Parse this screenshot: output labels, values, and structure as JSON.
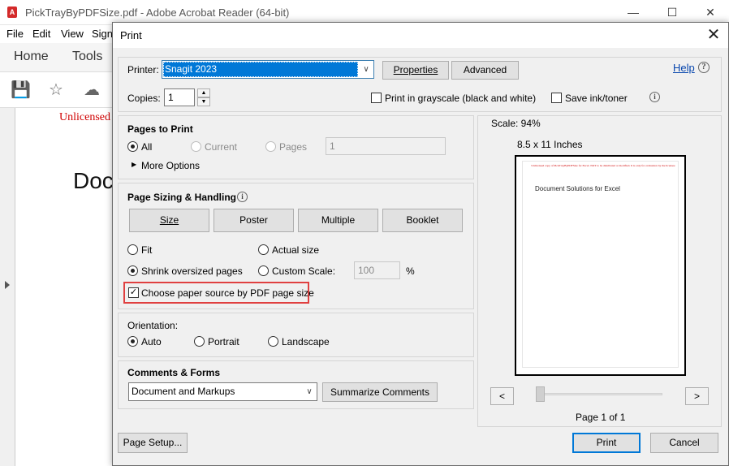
{
  "background": {
    "window_title": "PickTrayByPDFSize.pdf - Adobe Acrobat Reader (64-bit)",
    "menu": [
      "File",
      "Edit",
      "View",
      "Sign"
    ],
    "tabs": [
      "Home",
      "Tools"
    ],
    "watermark_text": "Unlicensed",
    "doc_text": "Doc"
  },
  "dialog": {
    "title": "Print",
    "printer": {
      "label": "Printer:",
      "value": "Snagit 2023"
    },
    "properties_button": "Properties",
    "advanced_button": "Advanced",
    "help_link": "Help",
    "copies": {
      "label": "Copies:",
      "value": "1"
    },
    "grayscale": {
      "label": "Print in grayscale (black and white)",
      "checked": false
    },
    "save_ink": {
      "label": "Save ink/toner",
      "checked": false
    },
    "pages_to_print": {
      "heading": "Pages to Print",
      "all": "All",
      "current": "Current",
      "pages": "Pages",
      "pages_value": "1",
      "more_options": "More Options"
    },
    "sizing": {
      "heading": "Page Sizing & Handling",
      "buttons": [
        "Size",
        "Poster",
        "Multiple",
        "Booklet"
      ],
      "fit": "Fit",
      "actual_size": "Actual size",
      "shrink": "Shrink oversized pages",
      "custom_scale": "Custom Scale:",
      "custom_scale_value": "100",
      "percent": "%",
      "paper_source": "Choose paper source by PDF page size",
      "highlight_color": "#e04040"
    },
    "orientation": {
      "heading": "Orientation:",
      "auto": "Auto",
      "portrait": "Portrait",
      "landscape": "Landscape"
    },
    "comments": {
      "heading": "Comments & Forms",
      "value": "Document and Markups",
      "summarize_button": "Summarize Comments"
    },
    "preview": {
      "scale": "Scale:  94%",
      "paper_size": "8.5 x 11 Inches",
      "page_red_text": "Unlicensed copy of PickTrayByPDFSize for Excel. NOT to be distributed or modified. It is only for evaluation by the licensee",
      "page_body_text": "Document Solutions for Excel",
      "prev": "<",
      "next": ">",
      "page_indicator": "Page 1 of 1"
    },
    "page_setup_button": "Page Setup...",
    "print_button": "Print",
    "cancel_button": "Cancel"
  }
}
